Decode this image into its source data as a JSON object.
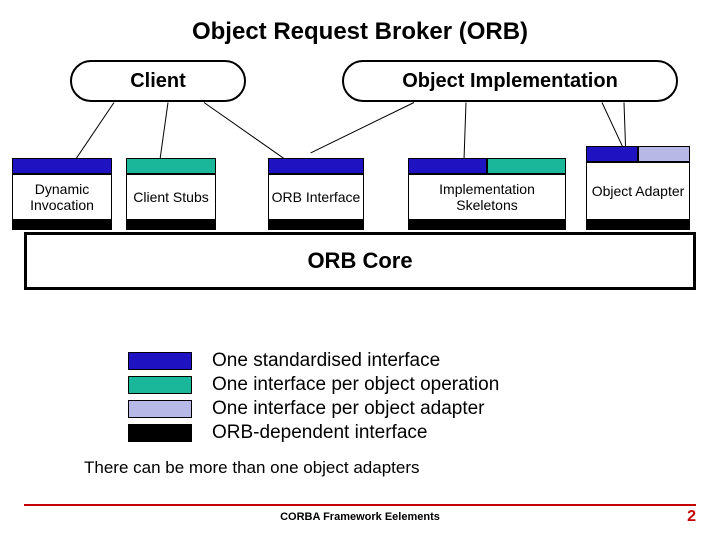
{
  "title": "Object Request Broker (ORB)",
  "top_boxes": {
    "client": "Client",
    "impl": "Object Implementation"
  },
  "components": {
    "dyn_inv": "Dynamic Invocation",
    "client_stubs": "Client Stubs",
    "orb_iface": "ORB Interface",
    "impl_skel": "Implementation Skeletons",
    "obj_adapter": "Object Adapter"
  },
  "orb_core": "ORB Core",
  "legend": [
    {
      "color": "blue",
      "text": "One standardised interface"
    },
    {
      "color": "teal",
      "text": "One interface per object operation"
    },
    {
      "color": "lilac",
      "text": "One interface per object adapter"
    },
    {
      "color": "black",
      "text": "ORB-dependent interface"
    }
  ],
  "note": "There can be more than one object adapters",
  "footer": {
    "center": "CORBA Framework Eelements",
    "page": "2"
  },
  "colors": {
    "blue": "#1f12c1",
    "teal": "#1bb79a",
    "lilac": "#b7b8e6",
    "black": "#000000",
    "accent_red": "#c40000"
  }
}
